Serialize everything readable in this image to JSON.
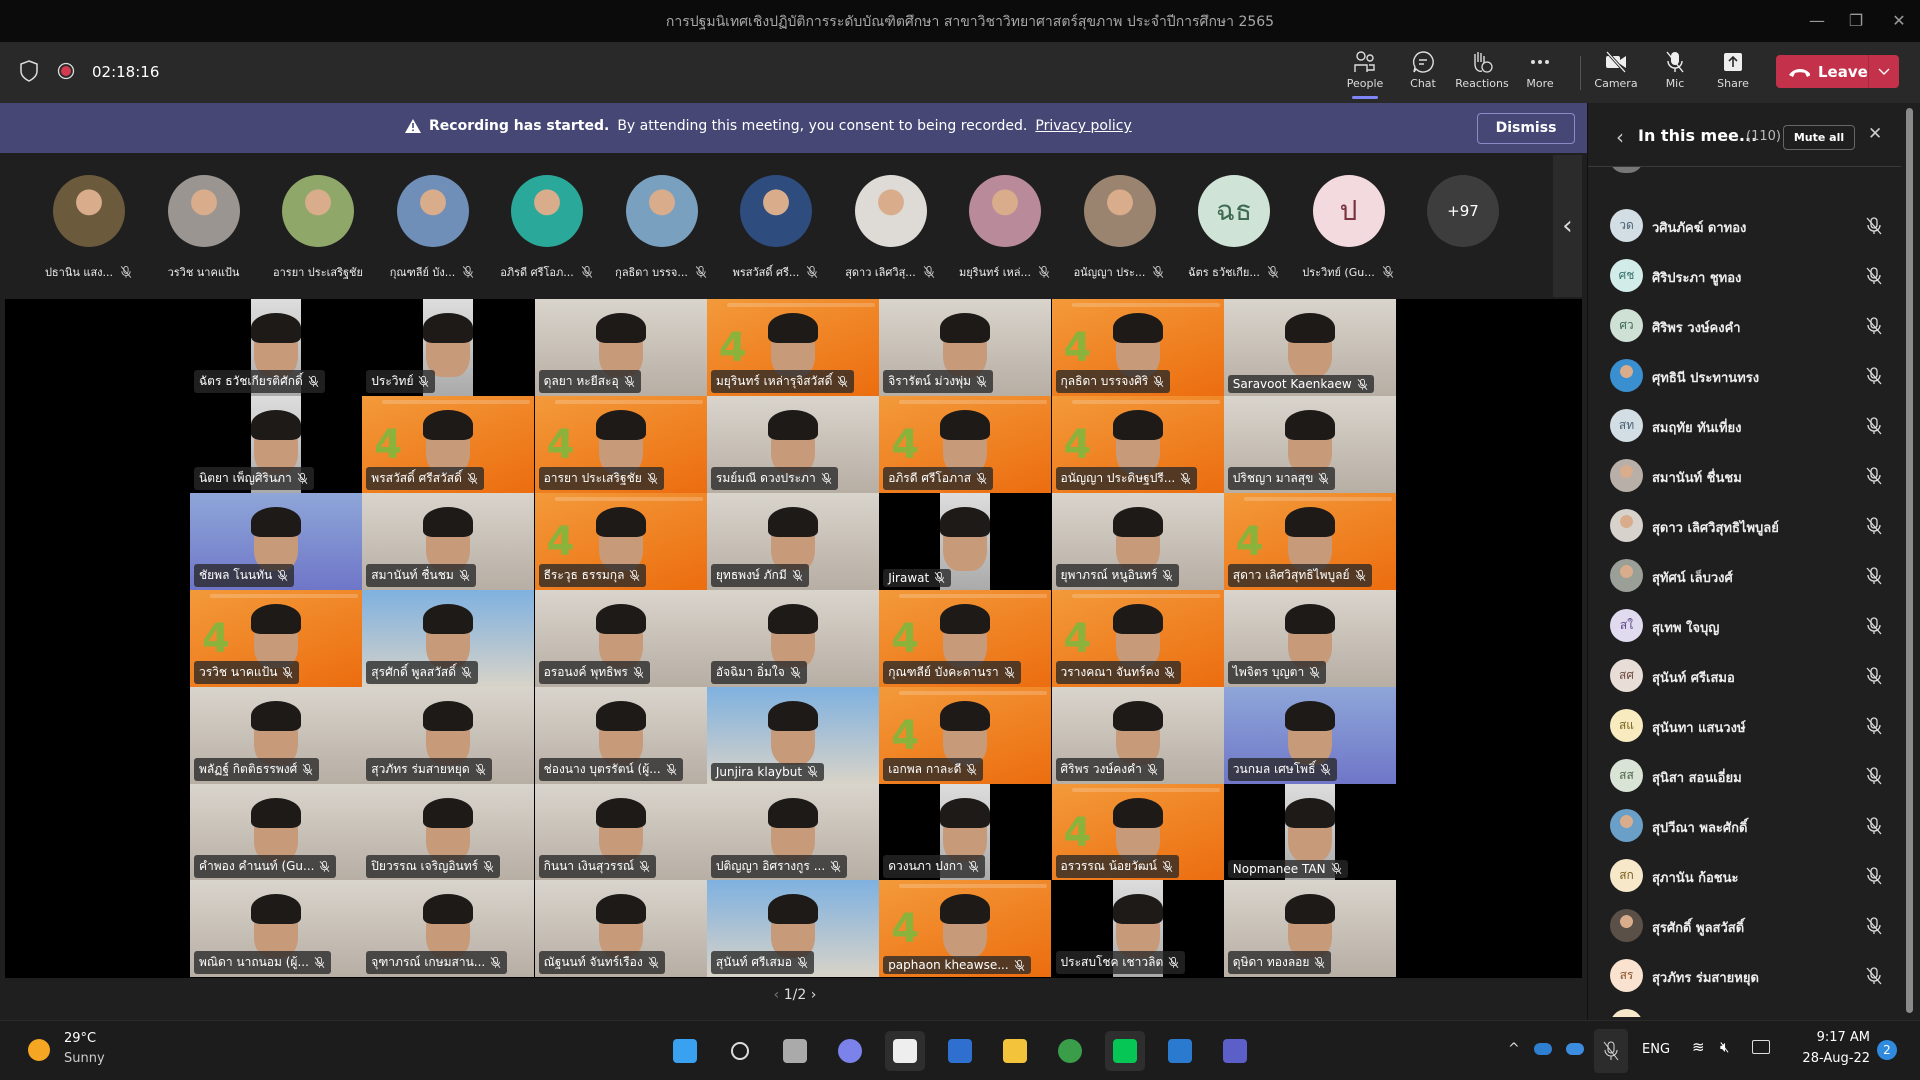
{
  "window": {
    "title": "การปฐมนิเทศเชิงปฏิบัติการระดับบัณฑิตศึกษา สาขาวิชาวิทยาศาสตร์สุขภาพ ประจำปีการศึกษา 2565",
    "minimize": "—",
    "restore": "❐",
    "close": "✕"
  },
  "toolbar": {
    "timer": "02:18:16",
    "people": "People",
    "chat": "Chat",
    "reactions": "Reactions",
    "more": "More",
    "camera": "Camera",
    "mic": "Mic",
    "share": "Share",
    "leave": "Leave",
    "leave_color": "#c4314b",
    "active_tab": "People"
  },
  "banner": {
    "title": "Recording has started.",
    "text": "By attending this meeting, you consent to being recorded.",
    "link": "Privacy policy",
    "dismiss": "Dismiss",
    "color": "#464775"
  },
  "strip": {
    "participants": [
      {
        "name": "ปธานิน แสง...",
        "muted": true,
        "photo": "#6b5a3c"
      },
      {
        "name": "วรวิช นาคแป้น",
        "muted": false,
        "photo": "#9a9590"
      },
      {
        "name": "อารยา ประเสริฐชัย",
        "muted": false,
        "photo": "#8fa86a"
      },
      {
        "name": "กุณฑลีย์ บัง...",
        "muted": true,
        "photo": "#6f8fb8"
      },
      {
        "name": "อภิรดี ศรีโอภ...",
        "muted": true,
        "photo": "#2aa89a"
      },
      {
        "name": "กุลธิดา บรรจ...",
        "muted": true,
        "photo": "#7aa0c0"
      },
      {
        "name": "พรสวัสดิ์ ศรี...",
        "muted": true,
        "photo": "#2e4c7e"
      },
      {
        "name": "สุดาว เลิศวิสุ...",
        "muted": true,
        "photo": "#dedad6"
      },
      {
        "name": "มยุรินทร์ เหล่...",
        "muted": true,
        "photo": "#b98a9a"
      },
      {
        "name": "อนัญญา ประ...",
        "muted": true,
        "photo": "#9a8470"
      },
      {
        "name": "ฉัตร ธวัชเกีย...",
        "muted": true,
        "initials": "ฉธ",
        "bg": "#cfe3d6",
        "fg": "#3f6a52"
      },
      {
        "name": "ประวิทย์ (Gu...",
        "muted": true,
        "initials": "ป",
        "bg": "#f3dade",
        "fg": "#7a3440"
      }
    ],
    "overflow": "+97",
    "collapse": "‹"
  },
  "grid": {
    "tiles": [
      {
        "name": "ฉัตร ธวัชเกียรติศักดิ์",
        "style": "dark"
      },
      {
        "name": "ประวิทย์",
        "style": "dark"
      },
      {
        "name": "ดุลยา หะยีสะอุ",
        "style": "room"
      },
      {
        "name": "มยุรินทร์ เหล่ารุจิสวัสดิ์",
        "style": "orange"
      },
      {
        "name": "จิรารัตน์ ม่วงพุ่ม",
        "style": "room"
      },
      {
        "name": "กุลธิดา บรรจงศิริ",
        "style": "orange"
      },
      {
        "name": "Saravoot Kaenkaew",
        "style": "room"
      },
      {
        "name": "นิตยา เพ็ญศิรินภา",
        "style": "dark"
      },
      {
        "name": "พรสวัสดิ์ ศรีสวัสดิ์",
        "style": "orange"
      },
      {
        "name": "อารยา ประเสริฐชัย",
        "style": "orange"
      },
      {
        "name": "รมย์มณี ดวงประภา",
        "style": "room"
      },
      {
        "name": "อภิรดี ศรีโอภาส",
        "style": "orange"
      },
      {
        "name": "อนัญญา ประดิษฐปรี...",
        "style": "orange"
      },
      {
        "name": "ปริชญา มาลสุข",
        "style": "room"
      },
      {
        "name": "ชัยพล โนนทัน",
        "style": "blue"
      },
      {
        "name": "สมานันท์ ชื่นชม",
        "style": "room"
      },
      {
        "name": "ธีระวุธ ธรรมกุล",
        "style": "orange"
      },
      {
        "name": "ยุทธพงษ์ ภักมี",
        "style": "room"
      },
      {
        "name": "Jirawat",
        "style": "dark"
      },
      {
        "name": "ยุพาภรณ์ หนูอินทร์",
        "style": "room"
      },
      {
        "name": "สุดาว เลิศวิสุทธิไพบูลย์",
        "style": "orange"
      },
      {
        "name": "วรวิช นาคแป้น",
        "style": "orange"
      },
      {
        "name": "สุรศักดิ์ พูลสวัสดิ์",
        "style": "sky"
      },
      {
        "name": "อรอนงค์ พุทธิพร",
        "style": "room"
      },
      {
        "name": "อัจฉิมา อิ่มใจ",
        "style": "room"
      },
      {
        "name": "กุณฑลีย์ บังคะดานรา",
        "style": "orange"
      },
      {
        "name": "วรางคณา จันทร์คง",
        "style": "orange"
      },
      {
        "name": "ไพจิตร บุญตา",
        "style": "room"
      },
      {
        "name": "พลัฏฐ์ กิตติธรรพงศ์",
        "style": "room"
      },
      {
        "name": "สุวภัทร ร่มสายหยุด",
        "style": "room"
      },
      {
        "name": "ช่องนาง บุตรรัตน์ (ผู้...",
        "style": "room"
      },
      {
        "name": "Junjira klaybut",
        "style": "sky"
      },
      {
        "name": "เอกพล กาละดี",
        "style": "orange"
      },
      {
        "name": "ศิริพร วงษ์คงคำ",
        "style": "room"
      },
      {
        "name": "วนกมล เศษโพธิ์",
        "style": "blue"
      },
      {
        "name": "คำพอง คำนนท์ (Gu...",
        "style": "room"
      },
      {
        "name": "ปิยวรรณ เจริญอินทร์",
        "style": "room"
      },
      {
        "name": "กินนา เงินสุวรรณ์",
        "style": "room"
      },
      {
        "name": "ปติญญา อิศรางกูร ...",
        "style": "room"
      },
      {
        "name": "ดวงนภา ปงกา",
        "style": "dark"
      },
      {
        "name": "อรวรรณ น้อยวัฒน์",
        "style": "orange"
      },
      {
        "name": "Nopmanee TAN",
        "style": "dark"
      },
      {
        "name": "พณิดา นาถนอม (ผู้...",
        "style": "room"
      },
      {
        "name": "จุฑาภรณ์ เกษมสาน...",
        "style": "room"
      },
      {
        "name": "ณัฐนนท์ จันทร์เรือง",
        "style": "room"
      },
      {
        "name": "สุนันท์ ศรีเสมอ",
        "style": "sky"
      },
      {
        "name": "paphaon kheawse...",
        "style": "orange"
      },
      {
        "name": "ประสบโชค เชาวลิต",
        "style": "dark"
      },
      {
        "name": "ดุษิดา ทองลอย",
        "style": "room"
      }
    ],
    "page": "1/2"
  },
  "sidebar": {
    "title": "In this mee...",
    "count": "(110)",
    "mute_all": "Mute all",
    "back": "‹",
    "close": "✕",
    "people": [
      {
        "name": "วศินภัคฆ์ ดาทอง",
        "initials": "วด",
        "bg": "#d3dde4",
        "fg": "#4a6274"
      },
      {
        "name": "ศิริประภา ชูทอง",
        "initials": "ศช",
        "bg": "#d2ece9",
        "fg": "#3a716b"
      },
      {
        "name": "ศิริพร วงษ์คงคำ",
        "initials": "ศว",
        "bg": "#cfe0d5",
        "fg": "#3f6a52"
      },
      {
        "name": "ศุทธินี ประทานทรง",
        "photo": "#3a8fd0"
      },
      {
        "name": "สมฤทัย ทันเที่ยง",
        "initials": "สท",
        "bg": "#d3dde4",
        "fg": "#4a6274"
      },
      {
        "name": "สมานันท์ ชื่นชม",
        "photo": "#b8b0a8"
      },
      {
        "name": "สุดาว เลิศวิสุทธิไพบูลย์",
        "photo": "#d8d2cc"
      },
      {
        "name": "สุทัศน์ เล็บวงศ์",
        "photo": "#9aa098"
      },
      {
        "name": "สุเทพ ใจบุญ",
        "initials": "สใ",
        "bg": "#e1dbf0",
        "fg": "#5b4d86"
      },
      {
        "name": "สุนันท์ ศรีเสมอ",
        "initials": "สศ",
        "bg": "#e9ddd8",
        "fg": "#6d4c42"
      },
      {
        "name": "สุนันทา แสนวงษ์",
        "initials": "สแ",
        "bg": "#f8ebc0",
        "fg": "#7a6420"
      },
      {
        "name": "สุนิสา สอนเอี่ยม",
        "initials": "สส",
        "bg": "#d9e3d6",
        "fg": "#4d6648"
      },
      {
        "name": "สุปวีณา พละศักดิ์",
        "photo": "#6aa0c8"
      },
      {
        "name": "สุภานัน ก้อชนะ",
        "initials": "สก",
        "bg": "#f6e8c8",
        "fg": "#7a5e20"
      },
      {
        "name": "สุรศักดิ์ พูลสวัสดิ์",
        "photo": "#5a5048"
      },
      {
        "name": "สุวภัทร ร่มสายหยุด",
        "initials": "สร",
        "bg": "#f9e3d0",
        "fg": "#8a5530"
      }
    ]
  },
  "taskbar": {
    "temp": "29°C",
    "weather": "Sunny",
    "lang": "ENG",
    "time": "9:17 AM",
    "date": "28-Aug-22",
    "notifications": "2",
    "apps": [
      "start",
      "search",
      "task-view",
      "teams-chat",
      "snipping-tool",
      "remote-desktop",
      "file-explorer",
      "chrome",
      "line",
      "photos",
      "teams"
    ]
  }
}
